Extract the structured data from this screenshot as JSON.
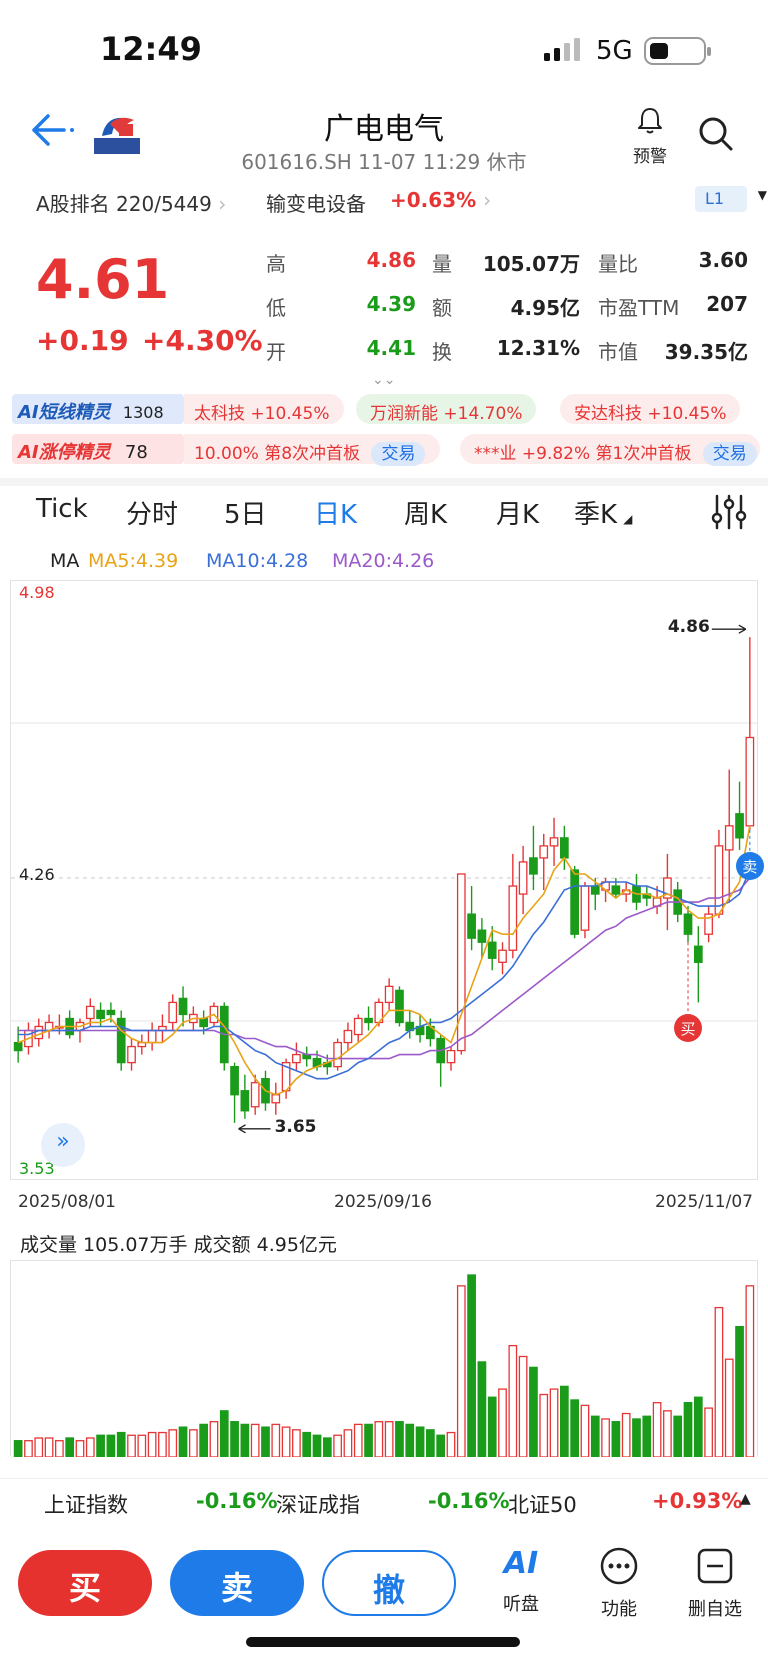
{
  "status": {
    "time": "12:49",
    "network": "5G"
  },
  "header": {
    "stock_name": "广电电气",
    "subline": "601616.SH 11-07 11:29 休市",
    "alert_label": "预警"
  },
  "rankrow": {
    "rank": "A股排名 220/5449",
    "sector": "输变电设备",
    "sector_change": "+0.63%",
    "level": "L1"
  },
  "quote": {
    "price": "4.61",
    "change": "+0.19",
    "change_pct": "+4.30%",
    "stats": [
      {
        "label": "高",
        "value": "4.86",
        "color": "#e63535"
      },
      {
        "label": "量",
        "value": "105.07万",
        "color": "#222222"
      },
      {
        "label": "量比",
        "value": "3.60",
        "color": "#222222"
      },
      {
        "label": "低",
        "value": "4.39",
        "color": "#1a9b1a"
      },
      {
        "label": "额",
        "value": "4.95亿",
        "color": "#222222"
      },
      {
        "label": "市盈TTM",
        "value": "207",
        "color": "#222222"
      },
      {
        "label": "开",
        "value": "4.41",
        "color": "#1a9b1a"
      },
      {
        "label": "换",
        "value": "12.31%",
        "color": "#222222"
      },
      {
        "label": "市值",
        "value": "39.35亿",
        "color": "#222222"
      }
    ],
    "expand_glyph": "⌄⌄"
  },
  "ai": {
    "row1_badge": "AI短线精灵",
    "row1_count": "1308",
    "row1_items": [
      "太科技 +10.45%",
      "万润新能 +14.70%",
      "安达科技 +10.45%"
    ],
    "row2_badge": "AI涨停精灵",
    "row2_count": "78",
    "row2_items": [
      "10.00% 第8次冲首板",
      "***业 +9.82% 第1次冲首板"
    ],
    "trade_label": "交易"
  },
  "tabs": [
    "Tick",
    "分时",
    "5日",
    "日K",
    "周K",
    "月K",
    "季K"
  ],
  "active_tab": "日K",
  "ma_legend": {
    "ma": "MA",
    "ma5": "MA5:4.39",
    "ma10": "MA10:4.28",
    "ma20": "MA20:4.26",
    "ma5_color": "#e8a317",
    "ma10_color": "#3a6fd8",
    "ma20_color": "#9b59c9"
  },
  "chart_data": {
    "type": "candlestick",
    "ylim": [
      3.53,
      4.98
    ],
    "y_labels": {
      "top": "4.98",
      "mid": "4.26",
      "bottom": "3.53"
    },
    "x_labels": [
      "2025/08/01",
      "2025/09/16",
      "2025/11/07"
    ],
    "high_marker": "4.86",
    "low_marker": "3.65",
    "sell_label": "卖",
    "buy_label": "买",
    "candles": [
      {
        "o": 3.85,
        "h": 3.89,
        "l": 3.8,
        "c": 3.83
      },
      {
        "o": 3.84,
        "h": 3.9,
        "l": 3.82,
        "c": 3.88
      },
      {
        "o": 3.86,
        "h": 3.91,
        "l": 3.84,
        "c": 3.89
      },
      {
        "o": 3.88,
        "h": 3.92,
        "l": 3.86,
        "c": 3.9
      },
      {
        "o": 3.89,
        "h": 3.92,
        "l": 3.87,
        "c": 3.89
      },
      {
        "o": 3.91,
        "h": 3.93,
        "l": 3.86,
        "c": 3.87
      },
      {
        "o": 3.88,
        "h": 3.91,
        "l": 3.85,
        "c": 3.9
      },
      {
        "o": 3.91,
        "h": 3.96,
        "l": 3.89,
        "c": 3.94
      },
      {
        "o": 3.93,
        "h": 3.95,
        "l": 3.89,
        "c": 3.91
      },
      {
        "o": 3.93,
        "h": 3.95,
        "l": 3.9,
        "c": 3.92
      },
      {
        "o": 3.91,
        "h": 3.93,
        "l": 3.78,
        "c": 3.8
      },
      {
        "o": 3.8,
        "h": 3.86,
        "l": 3.78,
        "c": 3.84
      },
      {
        "o": 3.84,
        "h": 3.87,
        "l": 3.82,
        "c": 3.85
      },
      {
        "o": 3.85,
        "h": 3.9,
        "l": 3.83,
        "c": 3.88
      },
      {
        "o": 3.88,
        "h": 3.92,
        "l": 3.85,
        "c": 3.89
      },
      {
        "o": 3.9,
        "h": 3.97,
        "l": 3.88,
        "c": 3.95
      },
      {
        "o": 3.96,
        "h": 3.99,
        "l": 3.89,
        "c": 3.92
      },
      {
        "o": 3.9,
        "h": 3.94,
        "l": 3.88,
        "c": 3.92
      },
      {
        "o": 3.91,
        "h": 3.93,
        "l": 3.87,
        "c": 3.89
      },
      {
        "o": 3.9,
        "h": 3.95,
        "l": 3.89,
        "c": 3.94
      },
      {
        "o": 3.94,
        "h": 3.95,
        "l": 3.78,
        "c": 3.8
      },
      {
        "o": 3.79,
        "h": 3.8,
        "l": 3.65,
        "c": 3.72
      },
      {
        "o": 3.73,
        "h": 3.77,
        "l": 3.66,
        "c": 3.68
      },
      {
        "o": 3.69,
        "h": 3.77,
        "l": 3.67,
        "c": 3.75
      },
      {
        "o": 3.76,
        "h": 3.78,
        "l": 3.68,
        "c": 3.7
      },
      {
        "o": 3.7,
        "h": 3.75,
        "l": 3.67,
        "c": 3.72
      },
      {
        "o": 3.73,
        "h": 3.81,
        "l": 3.71,
        "c": 3.8
      },
      {
        "o": 3.8,
        "h": 3.85,
        "l": 3.78,
        "c": 3.82
      },
      {
        "o": 3.82,
        "h": 3.84,
        "l": 3.79,
        "c": 3.81
      },
      {
        "o": 3.81,
        "h": 3.83,
        "l": 3.78,
        "c": 3.79
      },
      {
        "o": 3.8,
        "h": 3.82,
        "l": 3.77,
        "c": 3.79
      },
      {
        "o": 3.79,
        "h": 3.86,
        "l": 3.78,
        "c": 3.85
      },
      {
        "o": 3.85,
        "h": 3.9,
        "l": 3.83,
        "c": 3.88
      },
      {
        "o": 3.87,
        "h": 3.92,
        "l": 3.85,
        "c": 3.91
      },
      {
        "o": 3.91,
        "h": 3.94,
        "l": 3.88,
        "c": 3.9
      },
      {
        "o": 3.9,
        "h": 3.96,
        "l": 3.89,
        "c": 3.95
      },
      {
        "o": 3.95,
        "h": 4.01,
        "l": 3.93,
        "c": 3.99
      },
      {
        "o": 3.98,
        "h": 3.99,
        "l": 3.89,
        "c": 3.9
      },
      {
        "o": 3.9,
        "h": 3.93,
        "l": 3.86,
        "c": 3.88
      },
      {
        "o": 3.89,
        "h": 3.92,
        "l": 3.85,
        "c": 3.87
      },
      {
        "o": 3.89,
        "h": 3.91,
        "l": 3.84,
        "c": 3.86
      },
      {
        "o": 3.86,
        "h": 3.87,
        "l": 3.74,
        "c": 3.8
      },
      {
        "o": 3.8,
        "h": 3.84,
        "l": 3.78,
        "c": 3.83
      },
      {
        "o": 3.83,
        "h": 4.27,
        "l": 3.82,
        "c": 4.27
      },
      {
        "o": 4.17,
        "h": 4.24,
        "l": 4.08,
        "c": 4.11
      },
      {
        "o": 4.13,
        "h": 4.16,
        "l": 4.06,
        "c": 4.1
      },
      {
        "o": 4.1,
        "h": 4.14,
        "l": 4.03,
        "c": 4.06
      },
      {
        "o": 4.05,
        "h": 4.1,
        "l": 4.02,
        "c": 4.08
      },
      {
        "o": 4.08,
        "h": 4.32,
        "l": 4.06,
        "c": 4.24
      },
      {
        "o": 4.22,
        "h": 4.34,
        "l": 4.17,
        "c": 4.3
      },
      {
        "o": 4.31,
        "h": 4.39,
        "l": 4.23,
        "c": 4.27
      },
      {
        "o": 4.31,
        "h": 4.37,
        "l": 4.23,
        "c": 4.34
      },
      {
        "o": 4.34,
        "h": 4.41,
        "l": 4.29,
        "c": 4.36
      },
      {
        "o": 4.36,
        "h": 4.39,
        "l": 4.28,
        "c": 4.31
      },
      {
        "o": 4.28,
        "h": 4.29,
        "l": 4.11,
        "c": 4.12
      },
      {
        "o": 4.13,
        "h": 4.25,
        "l": 4.11,
        "c": 4.24
      },
      {
        "o": 4.24,
        "h": 4.26,
        "l": 4.18,
        "c": 4.22
      },
      {
        "o": 4.23,
        "h": 4.26,
        "l": 4.2,
        "c": 4.25
      },
      {
        "o": 4.24,
        "h": 4.26,
        "l": 4.21,
        "c": 4.22
      },
      {
        "o": 4.22,
        "h": 4.25,
        "l": 4.2,
        "c": 4.23
      },
      {
        "o": 4.24,
        "h": 4.27,
        "l": 4.18,
        "c": 4.2
      },
      {
        "o": 4.22,
        "h": 4.24,
        "l": 4.19,
        "c": 4.21
      },
      {
        "o": 4.19,
        "h": 4.24,
        "l": 4.17,
        "c": 4.21
      },
      {
        "o": 4.21,
        "h": 4.32,
        "l": 4.13,
        "c": 4.26
      },
      {
        "o": 4.23,
        "h": 4.25,
        "l": 4.15,
        "c": 4.17
      },
      {
        "o": 4.17,
        "h": 4.19,
        "l": 4.1,
        "c": 4.12
      },
      {
        "o": 4.09,
        "h": 4.14,
        "l": 3.95,
        "c": 4.05
      },
      {
        "o": 4.12,
        "h": 4.19,
        "l": 4.1,
        "c": 4.17
      },
      {
        "o": 4.17,
        "h": 4.38,
        "l": 4.16,
        "c": 4.34
      },
      {
        "o": 4.33,
        "h": 4.53,
        "l": 4.2,
        "c": 4.39
      },
      {
        "o": 4.42,
        "h": 4.5,
        "l": 4.33,
        "c": 4.36
      },
      {
        "o": 4.39,
        "h": 4.86,
        "l": 4.38,
        "c": 4.61
      }
    ],
    "ma5": [
      3.85,
      3.86,
      3.87,
      3.88,
      3.89,
      3.89,
      3.89,
      3.9,
      3.9,
      3.91,
      3.88,
      3.86,
      3.85,
      3.85,
      3.85,
      3.87,
      3.9,
      3.91,
      3.91,
      3.92,
      3.89,
      3.85,
      3.8,
      3.76,
      3.73,
      3.72,
      3.73,
      3.76,
      3.78,
      3.79,
      3.8,
      3.81,
      3.83,
      3.85,
      3.87,
      3.9,
      3.93,
      3.93,
      3.93,
      3.92,
      3.89,
      3.87,
      3.85,
      3.92,
      3.99,
      4.06,
      4.13,
      4.12,
      4.12,
      4.16,
      4.19,
      4.22,
      4.28,
      4.31,
      4.27,
      4.27,
      4.25,
      4.23,
      4.21,
      4.23,
      4.22,
      4.22,
      4.21,
      4.22,
      4.21,
      4.18,
      4.16,
      4.16,
      4.17,
      4.21,
      4.25,
      4.39
    ],
    "ma10": [
      3.87,
      3.87,
      3.88,
      3.88,
      3.88,
      3.88,
      3.88,
      3.89,
      3.89,
      3.89,
      3.89,
      3.88,
      3.88,
      3.88,
      3.88,
      3.88,
      3.88,
      3.88,
      3.88,
      3.89,
      3.89,
      3.87,
      3.85,
      3.83,
      3.82,
      3.8,
      3.79,
      3.78,
      3.77,
      3.76,
      3.76,
      3.77,
      3.78,
      3.8,
      3.81,
      3.83,
      3.85,
      3.86,
      3.88,
      3.89,
      3.9,
      3.9,
      3.91,
      3.93,
      3.95,
      3.97,
      3.99,
      4.01,
      4.04,
      4.08,
      4.12,
      4.15,
      4.19,
      4.23,
      4.24,
      4.24,
      4.24,
      4.25,
      4.25,
      4.25,
      4.24,
      4.24,
      4.23,
      4.22,
      4.21,
      4.2,
      4.19,
      4.19,
      4.19,
      4.2,
      4.22,
      4.28
    ],
    "ma20": [
      3.88,
      3.88,
      3.88,
      3.88,
      3.88,
      3.88,
      3.88,
      3.88,
      3.88,
      3.88,
      3.88,
      3.88,
      3.88,
      3.88,
      3.88,
      3.88,
      3.88,
      3.88,
      3.88,
      3.88,
      3.87,
      3.87,
      3.86,
      3.86,
      3.85,
      3.84,
      3.84,
      3.83,
      3.82,
      3.82,
      3.81,
      3.81,
      3.81,
      3.81,
      3.81,
      3.81,
      3.81,
      3.82,
      3.82,
      3.82,
      3.83,
      3.83,
      3.84,
      3.86,
      3.87,
      3.89,
      3.91,
      3.93,
      3.95,
      3.97,
      3.99,
      4.01,
      4.03,
      4.05,
      4.07,
      4.09,
      4.11,
      4.13,
      4.14,
      4.16,
      4.17,
      4.18,
      4.19,
      4.2,
      4.2,
      4.2,
      4.2,
      4.21,
      4.21,
      4.22,
      4.23,
      4.26
    ]
  },
  "volume": {
    "info": "成交量 105.07万手  成交额 4.95亿元",
    "values": [
      6,
      6,
      7,
      7,
      6,
      7,
      6,
      7,
      8,
      8,
      9,
      8,
      8,
      9,
      9,
      10,
      11,
      10,
      12,
      13,
      17,
      13,
      12,
      12,
      11,
      12,
      11,
      10,
      9,
      8,
      7,
      8,
      10,
      12,
      12,
      13,
      13,
      13,
      12,
      11,
      10,
      8,
      9,
      63,
      67,
      35,
      22,
      25,
      41,
      37,
      33,
      23,
      25,
      26,
      21,
      19,
      15,
      14,
      13,
      16,
      14,
      15,
      20,
      17,
      15,
      20,
      22,
      18,
      55,
      36,
      48,
      63
    ]
  },
  "indexbar": [
    {
      "name": "上证指数",
      "value": "-0.16%",
      "color": "#1a9b1a"
    },
    {
      "name": "深证成指",
      "value": "-0.16%",
      "color": "#1a9b1a"
    },
    {
      "name": "北证50",
      "value": "+0.93%",
      "color": "#e63535"
    }
  ],
  "bottombar": {
    "buy": "买",
    "sell": "卖",
    "cancel": "撤",
    "ai_label": "听盘",
    "ai_mark": "AI",
    "func_label": "功能",
    "del_label": "删自选"
  }
}
